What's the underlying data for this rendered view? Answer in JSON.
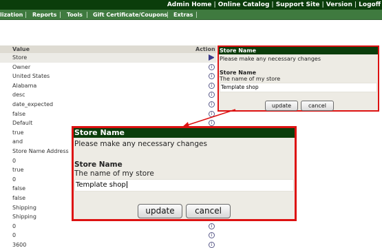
{
  "topbar": {
    "links": [
      "Admin Home",
      "Online Catalog",
      "Support Site",
      "Version",
      "Logoff"
    ]
  },
  "menubar": {
    "items": [
      "lization",
      "Reports",
      "Tools",
      "Gift Certificate/Coupons",
      "Extras"
    ]
  },
  "table": {
    "headers": {
      "value": "Value",
      "action": "Action"
    },
    "rows": [
      {
        "value": "Store",
        "action": "arrow-icon"
      },
      {
        "value": "Owner",
        "action": "info-icon"
      },
      {
        "value": "United States",
        "action": "info-icon"
      },
      {
        "value": "Alabama",
        "action": "info-icon"
      },
      {
        "value": "desc",
        "action": "info-icon"
      },
      {
        "value": "date_expected",
        "action": "info-icon"
      },
      {
        "value": "false",
        "action": "info-icon"
      },
      {
        "value": "Default",
        "action": "info-icon"
      },
      {
        "value": "true",
        "action": "info-icon"
      },
      {
        "value": "and",
        "action": "info-icon"
      },
      {
        "value": "Store Name Address",
        "action": "info-icon"
      },
      {
        "value": "0",
        "action": "info-icon"
      },
      {
        "value": "true",
        "action": "info-icon"
      },
      {
        "value": "0",
        "action": "info-icon"
      },
      {
        "value": "false",
        "action": "info-icon"
      },
      {
        "value": "false",
        "action": "info-icon"
      },
      {
        "value": "Shipping",
        "action": "info-icon"
      },
      {
        "value": "Shipping",
        "action": "info-icon"
      },
      {
        "value": "0",
        "action": "info-icon"
      },
      {
        "value": "0",
        "action": "info-icon"
      },
      {
        "value": "3600",
        "action": "info-icon"
      }
    ]
  },
  "edit_box": {
    "title": "Store Name",
    "instruction": "Please make any necessary changes",
    "field_label": "Store Name",
    "field_description": "The name of my store",
    "field_value": "Template shop",
    "update_label": "update",
    "cancel_label": "cancel"
  },
  "colors": {
    "header_green": "#0b3d0b",
    "menu_green": "#3f7a3f",
    "highlight_red": "#dd1111",
    "panel_bg": "#edebe4"
  }
}
